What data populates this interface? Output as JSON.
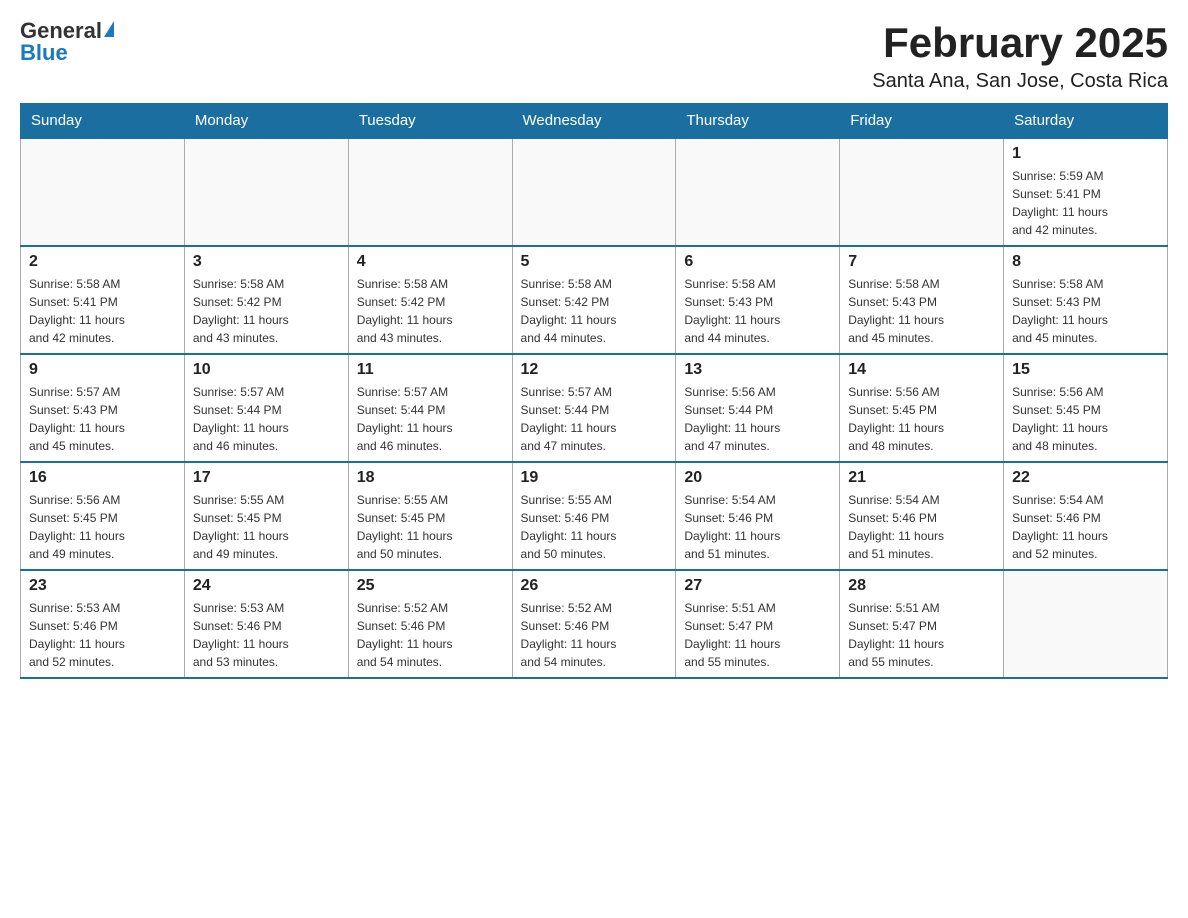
{
  "header": {
    "logo_general": "General",
    "logo_blue": "Blue",
    "main_title": "February 2025",
    "subtitle": "Santa Ana, San Jose, Costa Rica"
  },
  "weekdays": [
    "Sunday",
    "Monday",
    "Tuesday",
    "Wednesday",
    "Thursday",
    "Friday",
    "Saturday"
  ],
  "weeks": [
    [
      {
        "day": "",
        "info": ""
      },
      {
        "day": "",
        "info": ""
      },
      {
        "day": "",
        "info": ""
      },
      {
        "day": "",
        "info": ""
      },
      {
        "day": "",
        "info": ""
      },
      {
        "day": "",
        "info": ""
      },
      {
        "day": "1",
        "info": "Sunrise: 5:59 AM\nSunset: 5:41 PM\nDaylight: 11 hours\nand 42 minutes."
      }
    ],
    [
      {
        "day": "2",
        "info": "Sunrise: 5:58 AM\nSunset: 5:41 PM\nDaylight: 11 hours\nand 42 minutes."
      },
      {
        "day": "3",
        "info": "Sunrise: 5:58 AM\nSunset: 5:42 PM\nDaylight: 11 hours\nand 43 minutes."
      },
      {
        "day": "4",
        "info": "Sunrise: 5:58 AM\nSunset: 5:42 PM\nDaylight: 11 hours\nand 43 minutes."
      },
      {
        "day": "5",
        "info": "Sunrise: 5:58 AM\nSunset: 5:42 PM\nDaylight: 11 hours\nand 44 minutes."
      },
      {
        "day": "6",
        "info": "Sunrise: 5:58 AM\nSunset: 5:43 PM\nDaylight: 11 hours\nand 44 minutes."
      },
      {
        "day": "7",
        "info": "Sunrise: 5:58 AM\nSunset: 5:43 PM\nDaylight: 11 hours\nand 45 minutes."
      },
      {
        "day": "8",
        "info": "Sunrise: 5:58 AM\nSunset: 5:43 PM\nDaylight: 11 hours\nand 45 minutes."
      }
    ],
    [
      {
        "day": "9",
        "info": "Sunrise: 5:57 AM\nSunset: 5:43 PM\nDaylight: 11 hours\nand 45 minutes."
      },
      {
        "day": "10",
        "info": "Sunrise: 5:57 AM\nSunset: 5:44 PM\nDaylight: 11 hours\nand 46 minutes."
      },
      {
        "day": "11",
        "info": "Sunrise: 5:57 AM\nSunset: 5:44 PM\nDaylight: 11 hours\nand 46 minutes."
      },
      {
        "day": "12",
        "info": "Sunrise: 5:57 AM\nSunset: 5:44 PM\nDaylight: 11 hours\nand 47 minutes."
      },
      {
        "day": "13",
        "info": "Sunrise: 5:56 AM\nSunset: 5:44 PM\nDaylight: 11 hours\nand 47 minutes."
      },
      {
        "day": "14",
        "info": "Sunrise: 5:56 AM\nSunset: 5:45 PM\nDaylight: 11 hours\nand 48 minutes."
      },
      {
        "day": "15",
        "info": "Sunrise: 5:56 AM\nSunset: 5:45 PM\nDaylight: 11 hours\nand 48 minutes."
      }
    ],
    [
      {
        "day": "16",
        "info": "Sunrise: 5:56 AM\nSunset: 5:45 PM\nDaylight: 11 hours\nand 49 minutes."
      },
      {
        "day": "17",
        "info": "Sunrise: 5:55 AM\nSunset: 5:45 PM\nDaylight: 11 hours\nand 49 minutes."
      },
      {
        "day": "18",
        "info": "Sunrise: 5:55 AM\nSunset: 5:45 PM\nDaylight: 11 hours\nand 50 minutes."
      },
      {
        "day": "19",
        "info": "Sunrise: 5:55 AM\nSunset: 5:46 PM\nDaylight: 11 hours\nand 50 minutes."
      },
      {
        "day": "20",
        "info": "Sunrise: 5:54 AM\nSunset: 5:46 PM\nDaylight: 11 hours\nand 51 minutes."
      },
      {
        "day": "21",
        "info": "Sunrise: 5:54 AM\nSunset: 5:46 PM\nDaylight: 11 hours\nand 51 minutes."
      },
      {
        "day": "22",
        "info": "Sunrise: 5:54 AM\nSunset: 5:46 PM\nDaylight: 11 hours\nand 52 minutes."
      }
    ],
    [
      {
        "day": "23",
        "info": "Sunrise: 5:53 AM\nSunset: 5:46 PM\nDaylight: 11 hours\nand 52 minutes."
      },
      {
        "day": "24",
        "info": "Sunrise: 5:53 AM\nSunset: 5:46 PM\nDaylight: 11 hours\nand 53 minutes."
      },
      {
        "day": "25",
        "info": "Sunrise: 5:52 AM\nSunset: 5:46 PM\nDaylight: 11 hours\nand 54 minutes."
      },
      {
        "day": "26",
        "info": "Sunrise: 5:52 AM\nSunset: 5:46 PM\nDaylight: 11 hours\nand 54 minutes."
      },
      {
        "day": "27",
        "info": "Sunrise: 5:51 AM\nSunset: 5:47 PM\nDaylight: 11 hours\nand 55 minutes."
      },
      {
        "day": "28",
        "info": "Sunrise: 5:51 AM\nSunset: 5:47 PM\nDaylight: 11 hours\nand 55 minutes."
      },
      {
        "day": "",
        "info": ""
      }
    ]
  ]
}
